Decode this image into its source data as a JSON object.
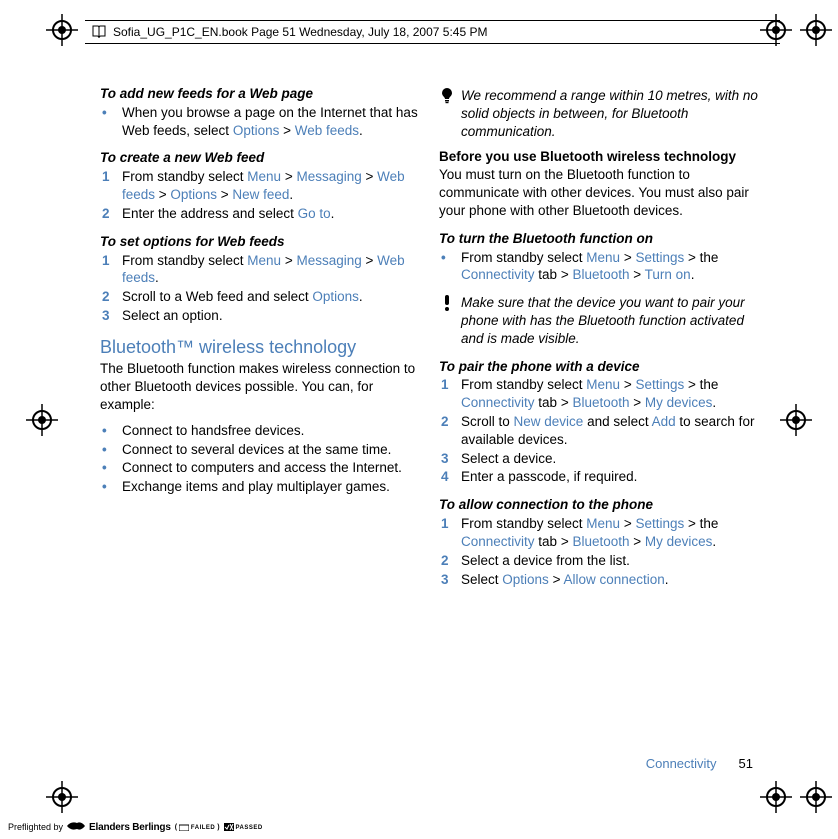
{
  "header": {
    "text": "Sofia_UG_P1C_EN.book  Page 51  Wednesday, July 18, 2007  5:45 PM"
  },
  "col1": {
    "h_add_feeds": "To add new feeds for a Web page",
    "add_feeds_item_pre": "When you browse a page on the Internet that has Web feeds, select ",
    "add_feeds_options": "Options",
    "gt1": " > ",
    "add_feeds_webfeeds": "Web feeds",
    "period": ".",
    "h_create": "To create a new Web feed",
    "create_s1_pre": "From standby select ",
    "menu": "Menu",
    "messaging": "Messaging",
    "webfeeds": "Web feeds",
    "options": "Options",
    "newfeed": "New feed",
    "create_s2_pre": "Enter the address and select ",
    "goto": "Go to",
    "h_set_options": "To set options for Web feeds",
    "set_s1_pre": "From standby select ",
    "set_s2": "Scroll to a Web feed and select ",
    "set_s2_options": "Options",
    "set_s3": "Select an option.",
    "bt_title": "Bluetooth™ wireless technology",
    "bt_intro": "The Bluetooth function makes wireless connection to other Bluetooth devices possible. You can, for example:",
    "bt_b1": "Connect to handsfree devices.",
    "bt_b2": "Connect to several devices at the same time.",
    "bt_b3": "Connect to computers and access the Internet.",
    "bt_b4": "Exchange items and play multiplayer games."
  },
  "col2": {
    "tip_range": "We recommend a range within 10 metres, with no solid objects in between, for Bluetooth communication.",
    "before_h": "Before you use Bluetooth wireless technology",
    "before_body": "You must turn on the Bluetooth function to communicate with other devices. You must also pair your phone with other Bluetooth devices.",
    "h_turn_on": "To turn the Bluetooth function on",
    "turn_on_pre": "From standby select ",
    "menu": "Menu",
    "settings": "Settings",
    "gt": " > ",
    "the_pre": " > the ",
    "connectivity": "Connectivity",
    "tab_gt": " tab > ",
    "bluetooth": "Bluetooth",
    "turnon": "Turn on",
    "period": ".",
    "tip_pair": "Make sure that the device you want to pair your phone with has the Bluetooth function activated and is made visible.",
    "h_pair": "To pair the phone with a device",
    "pair_s1_pre": "From standby select ",
    "mydevices": "My devices",
    "pair_s2_a": "Scroll to ",
    "newdevice": "New device",
    "pair_s2_b": " and select ",
    "add": "Add",
    "pair_s2_c": " to search for available devices.",
    "pair_s3": "Select a device.",
    "pair_s4": "Enter a passcode, if required.",
    "h_allow": "To allow connection to the phone",
    "allow_s1_pre": "From standby select ",
    "allow_s2": "Select a device from the list.",
    "allow_s3_a": "Select ",
    "options": "Options",
    "allowconn": "Allow connection"
  },
  "footer": {
    "section": "Connectivity",
    "page": "51"
  },
  "preflight": {
    "label": "Preflighted by",
    "logo": "Elanders Berlings",
    "failed": "FAILED",
    "passed": "PASSED"
  }
}
